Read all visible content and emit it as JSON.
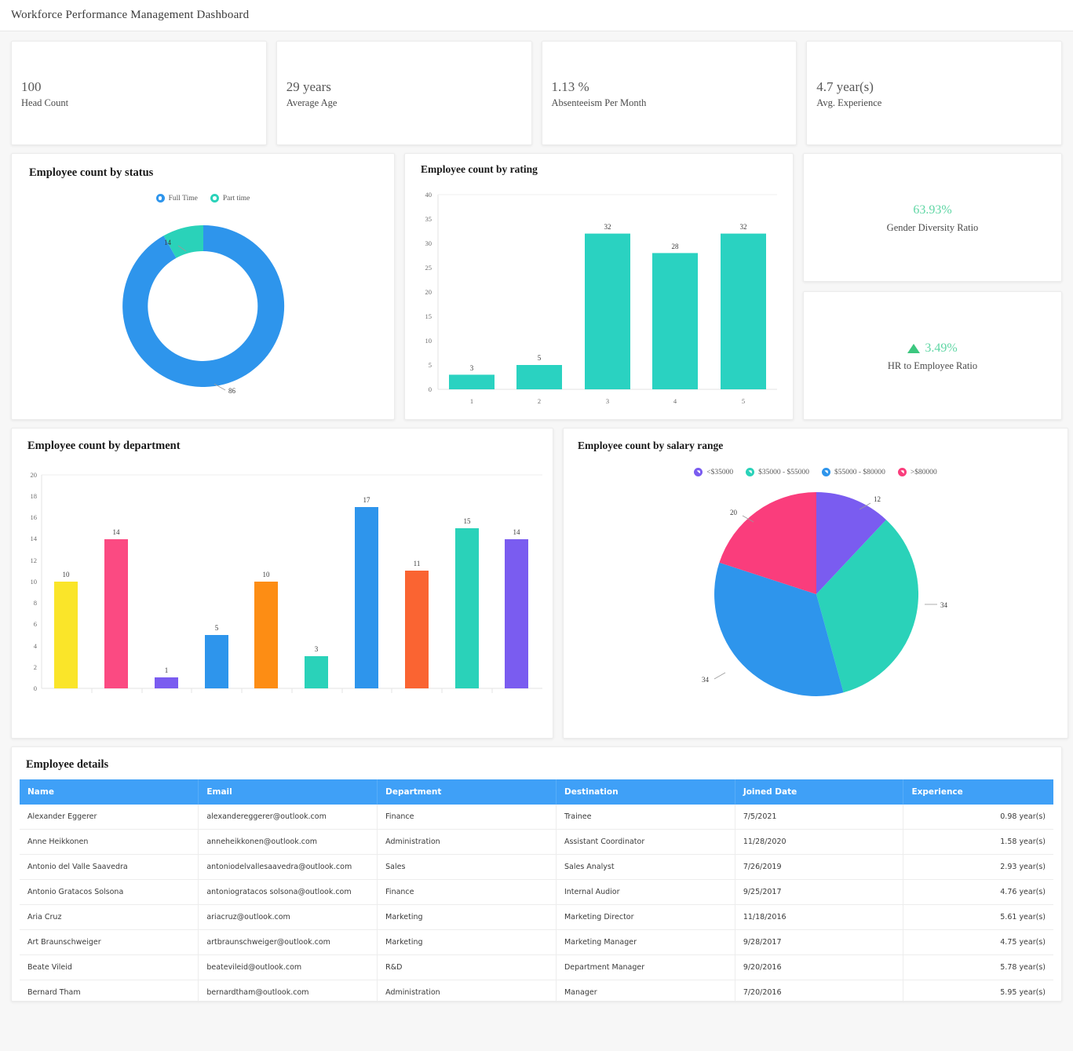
{
  "header": {
    "title": "Workforce Performance Management Dashboard"
  },
  "kpis": [
    {
      "value": "100",
      "label": "Head Count"
    },
    {
      "value": "29 years",
      "label": "Average Age"
    },
    {
      "value": "1.13 %",
      "label": "Absenteeism Per Month"
    },
    {
      "value": "4.7 year(s)",
      "label": "Avg. Experience"
    }
  ],
  "side_kpis": [
    {
      "value": "63.93%",
      "label": "Gender Diversity Ratio",
      "icon": "none",
      "color": "#5fd6a4"
    },
    {
      "value": "3.49%",
      "label": "HR to Employee Ratio",
      "icon": "triangle-up",
      "color": "#5fd6a4"
    }
  ],
  "cards": {
    "status_title": "Employee count by status",
    "rating_title": "Employee count by rating",
    "department_title": "Employee count by department",
    "salary_title": "Employee count by salary range",
    "table_title": "Employee details"
  },
  "chart_data": [
    {
      "type": "pie",
      "title": "Employee count by status",
      "variant": "donut",
      "categories": [
        "Full Time",
        "Part time"
      ],
      "values": [
        86,
        14
      ],
      "colors": [
        "#2e95ec",
        "#2ad2b9"
      ],
      "legend_position": "top"
    },
    {
      "type": "bar",
      "title": "Employee count by rating",
      "categories": [
        "1",
        "2",
        "3",
        "4",
        "5"
      ],
      "values": [
        3,
        5,
        32,
        28,
        32
      ],
      "color": "#2ad2c1",
      "xlabel": "",
      "ylabel": "",
      "ylim": [
        0,
        40
      ],
      "yticks": [
        0,
        5,
        10,
        15,
        20,
        25,
        30,
        35,
        40
      ],
      "grid": true
    },
    {
      "type": "bar",
      "title": "Employee count by department",
      "categories": [
        "",
        "",
        "",
        "",
        "",
        "",
        "",
        "",
        "",
        ""
      ],
      "values": [
        10,
        14,
        1,
        5,
        10,
        3,
        17,
        11,
        15,
        14
      ],
      "colors": [
        "#fae529",
        "#fb4a82",
        "#7a5cf0",
        "#2e95ec",
        "#fd8d14",
        "#2ad2b9",
        "#2e95ec",
        "#fa6432",
        "#2ad2b9",
        "#7a5cf0"
      ],
      "xlabel": "",
      "ylabel": "",
      "ylim": [
        0,
        20
      ],
      "yticks": [
        0,
        2,
        4,
        6,
        8,
        10,
        12,
        14,
        16,
        18,
        20
      ],
      "grid": true
    },
    {
      "type": "pie",
      "title": "Employee count by salary range",
      "categories": [
        "<$35000",
        "$35000 - $55000",
        "$55000 - $80000",
        ">$80000"
      ],
      "values": [
        12,
        34,
        34,
        20
      ],
      "colors": [
        "#7a5cf0",
        "#2ad2b9",
        "#2e95ec",
        "#fa3d7c"
      ],
      "legend_position": "top"
    }
  ],
  "table": {
    "columns": [
      "Name",
      "Email",
      "Department",
      "Destination",
      "Joined Date",
      "Experience"
    ],
    "rows": [
      [
        "Alexander Eggerer",
        "alexandereggerer@outlook.com",
        "Finance",
        "Trainee",
        "7/5/2021",
        "0.98 year(s)"
      ],
      [
        "Anne Heikkonen",
        "anneheikkonen@outlook.com",
        "Administration",
        "Assistant Coordinator",
        "11/28/2020",
        "1.58 year(s)"
      ],
      [
        "Antonio del Valle Saavedra",
        "antoniodelvallesaavedra@outlook.com",
        "Sales",
        "Sales Analyst",
        "7/26/2019",
        "2.93 year(s)"
      ],
      [
        "Antonio Gratacos Solsona",
        "antoniogratacos solsona@outlook.com",
        "Finance",
        "Internal Audior",
        "9/25/2017",
        "4.76 year(s)"
      ],
      [
        "Aria Cruz",
        "ariacruz@outlook.com",
        "Marketing",
        "Marketing Director",
        "11/18/2016",
        "5.61 year(s)"
      ],
      [
        "Art Braunschweiger",
        "artbraunschweiger@outlook.com",
        "Marketing",
        "Marketing Manager",
        "9/28/2017",
        "4.75 year(s)"
      ],
      [
        "Beate Vileid",
        "beatevileid@outlook.com",
        "R&D",
        "Department Manager",
        "9/20/2016",
        "5.78 year(s)"
      ],
      [
        "Bernard Tham",
        "bernardtham@outlook.com",
        "Administration",
        "Manager",
        "7/20/2016",
        "5.95 year(s)"
      ]
    ]
  }
}
